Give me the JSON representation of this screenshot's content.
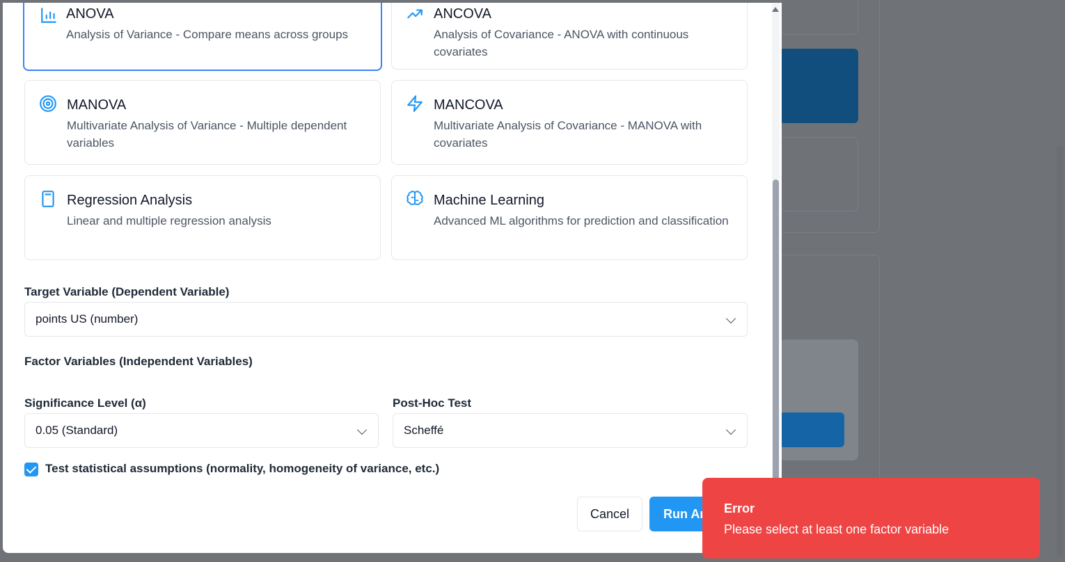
{
  "analysis_types": [
    {
      "title": "ANOVA",
      "description": "Analysis of Variance - Compare means across groups",
      "icon": "bar-chart-icon",
      "selected": true
    },
    {
      "title": "ANCOVA",
      "description": "Analysis of Covariance - ANOVA with continuous covariates",
      "icon": "trending-up-icon",
      "selected": false
    },
    {
      "title": "MANOVA",
      "description": "Multivariate Analysis of Variance - Multiple dependent variables",
      "icon": "target-icon",
      "selected": false
    },
    {
      "title": "MANCOVA",
      "description": "Multivariate Analysis of Covariance - MANOVA with covariates",
      "icon": "lightning-icon",
      "selected": false
    },
    {
      "title": "Regression Analysis",
      "description": "Linear and multiple regression analysis",
      "icon": "calculator-icon",
      "selected": false
    },
    {
      "title": "Machine Learning",
      "description": "Advanced ML algorithms for prediction and classification",
      "icon": "brain-icon",
      "selected": false
    }
  ],
  "target_variable": {
    "label": "Target Variable (Dependent Variable)",
    "value": "points US (number)"
  },
  "factor_variables": {
    "label": "Factor Variables (Independent Variables)"
  },
  "significance": {
    "label": "Significance Level (α)",
    "value": "0.05 (Standard)"
  },
  "posthoc": {
    "label": "Post-Hoc Test",
    "value": "Scheffé"
  },
  "assumptions": {
    "label": "Test statistical assumptions (normality, homogeneity of variance, etc.)",
    "checked": true
  },
  "actions": {
    "cancel": "Cancel",
    "run": "Run Analysis"
  },
  "toast": {
    "title": "Error",
    "message": "Please select at least one factor variable"
  },
  "colors": {
    "accent": "#2196f3",
    "error": "#ef4444",
    "selected_border": "#3b82f6"
  }
}
